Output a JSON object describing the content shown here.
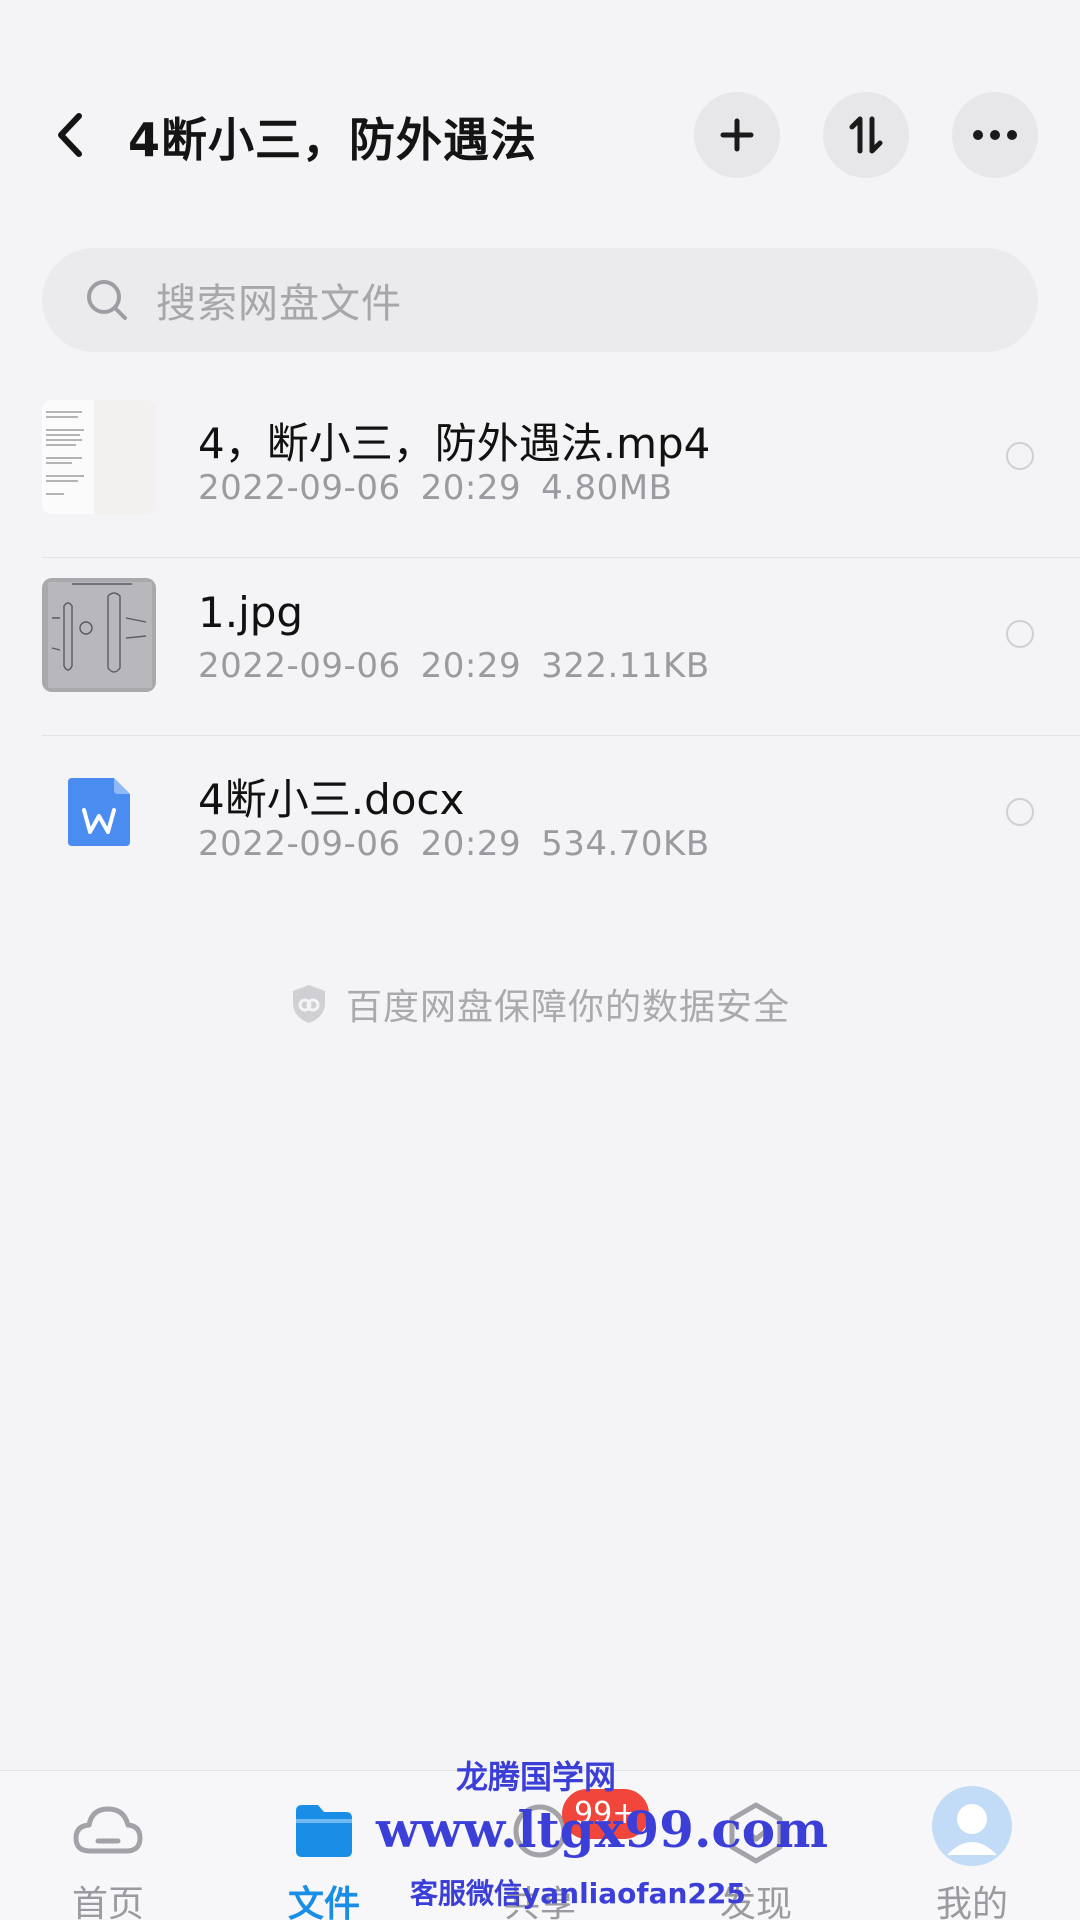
{
  "header": {
    "title": "4断小三，防外遇法",
    "back_icon": "chevron-left-icon",
    "add_icon": "plus-icon",
    "sort_icon": "sort-icon",
    "more_icon": "ellipsis-icon"
  },
  "search": {
    "placeholder": "搜索网盘文件",
    "icon": "search-icon"
  },
  "files": [
    {
      "name": "4，断小三，防外遇法.mp4",
      "date": "2022-09-06",
      "time": "20:29",
      "size": "4.80MB",
      "type": "video"
    },
    {
      "name": "1.jpg",
      "date": "2022-09-06",
      "time": "20:29",
      "size": "322.11KB",
      "type": "image"
    },
    {
      "name": "4断小三.docx",
      "date": "2022-09-06",
      "time": "20:29",
      "size": "534.70KB",
      "type": "word-document"
    }
  ],
  "safety_note": "百度网盘保障你的数据安全",
  "bottom_nav": {
    "items": [
      {
        "label": "首页",
        "icon": "cloud-icon",
        "active": false
      },
      {
        "label": "文件",
        "icon": "folder-icon",
        "active": true
      },
      {
        "label": "共享",
        "icon": "share-icon",
        "active": false
      },
      {
        "label": "发现",
        "icon": "discover-icon",
        "active": false
      },
      {
        "label": "我的",
        "icon": "avatar-icon",
        "active": false
      }
    ],
    "badge": "99+"
  },
  "watermark": {
    "line1": "龙腾国学网",
    "line2": "www.ltgx99.com",
    "line3": "客服微信yanliaofan225"
  },
  "colors": {
    "background": "#f4f4f6",
    "accent": "#1a8ee6",
    "badge": "#f0463c",
    "watermark": "#3b3fd8"
  }
}
